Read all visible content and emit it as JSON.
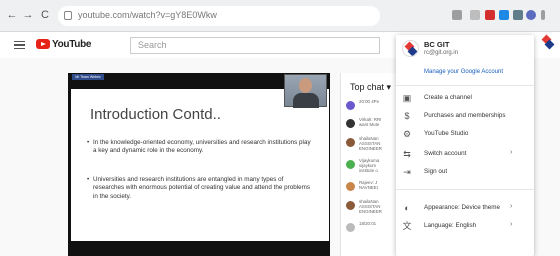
{
  "browser": {
    "back": "←",
    "forward": "→",
    "reload": "C",
    "url": "youtube.com/watch?v=gY8E0Wkw"
  },
  "youtube": {
    "logo_text": "YouTube",
    "search_placeholder": "Search"
  },
  "video": {
    "slide_tag": "Mr Team Webex",
    "slide_title": "Introduction Contd..",
    "bullets": [
      "In the knowledge-oriented economy, universities and research institutions play a key and dynamic role in the economy.",
      "Universities and research institutions are entangled in many types of researches with enormous potential of creating value and attend the problems in the society."
    ]
  },
  "chat": {
    "title": "Top chat",
    "dropdown_icon": "▾",
    "messages": [
      {
        "line1": "20:00 4Pe",
        "line2": "",
        "line3": "",
        "color": "#6a5acd"
      },
      {
        "line1": "Virkah: RRI",
        "line2": "want Mute",
        "line3": "",
        "color": "#333"
      },
      {
        "line1": "shailaNan",
        "line2": "ASSISTAN",
        "line3": "ENGINEER",
        "color": "#8a5a3a"
      },
      {
        "line1": "Vijaykuma",
        "line2": "vijaykum",
        "line3": "institute o",
        "color": "#4caf50"
      },
      {
        "line1": "Rajeev: J",
        "line2": "NAVNEEI",
        "line3": "",
        "color": "#c8864a"
      },
      {
        "line1": "shailaNan",
        "line2": "ASSISTAN",
        "line3": "ENGINEER",
        "color": "#8a5a3a"
      },
      {
        "line1": "18/20:01",
        "line2": "",
        "line3": "",
        "color": "#bbb"
      }
    ]
  },
  "account_menu": {
    "name": "BC GIT",
    "email": "rc@git.org.in",
    "manage": "Manage your Google Account",
    "items": [
      {
        "label": "Create a channel",
        "icon": "create-channel-icon",
        "glyph": "▣",
        "chevron": ""
      },
      {
        "label": "Purchases and memberships",
        "icon": "purchases-icon",
        "glyph": "$",
        "chevron": ""
      },
      {
        "label": "YouTube Studio",
        "icon": "studio-gear-icon",
        "glyph": "⚙",
        "chevron": ""
      },
      {
        "label": "Switch account",
        "icon": "switch-account-icon",
        "glyph": "⇆",
        "chevron": "›"
      },
      {
        "label": "Sign out",
        "icon": "sign-out-icon",
        "glyph": "⇥",
        "chevron": ""
      },
      {
        "label": "Appearance: Device theme",
        "icon": "appearance-icon",
        "glyph": "◐",
        "chevron": "›"
      },
      {
        "label": "Language: English",
        "icon": "language-icon",
        "glyph": "文",
        "chevron": "›"
      }
    ]
  },
  "colors": {
    "youtube_red": "#e62117",
    "link_blue": "#1a5fbf",
    "logo_red": "#e53935",
    "logo_navy": "#1e3a8a"
  }
}
